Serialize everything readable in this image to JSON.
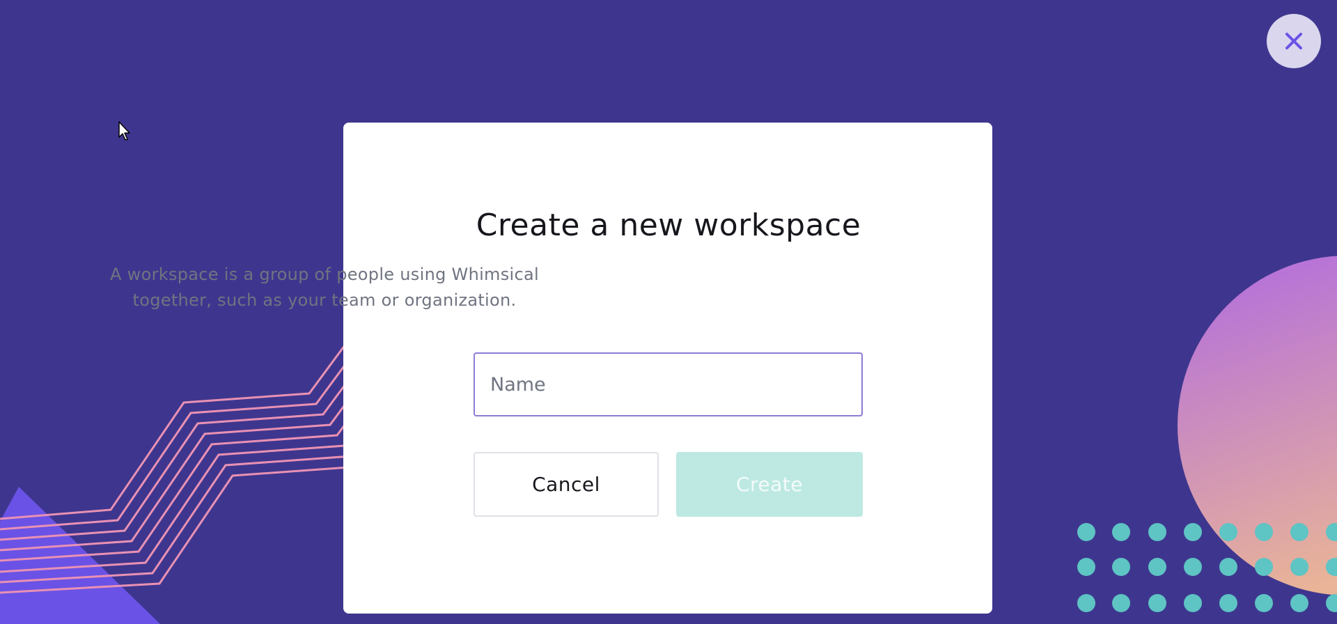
{
  "dialog": {
    "title": "Create a new workspace",
    "description": "A workspace is a group of people using Whimsical together, such as your team or organization.",
    "name_input": {
      "value": "",
      "placeholder": "Name"
    },
    "cancel_label": "Cancel",
    "create_label": "Create",
    "create_enabled": false
  },
  "close_button": {
    "icon": "close-icon"
  },
  "colors": {
    "background": "#3e368e",
    "dialog_background": "#ffffff",
    "input_focus_border": "#8d7ad8",
    "create_button_disabled": "#bde9e2",
    "decorative_lines": "#e991b4",
    "decorative_dots": "#5ec4c4",
    "decorative_triangle": "#6a52e6",
    "decorative_circle_top": "#b06ae0",
    "decorative_circle_bottom": "#e9b497"
  }
}
